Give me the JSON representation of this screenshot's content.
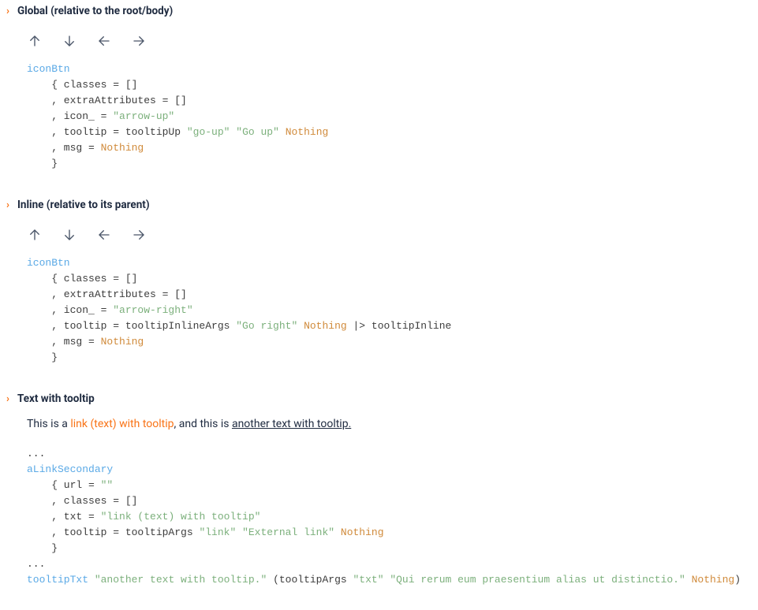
{
  "sections": {
    "global": {
      "title": "Global (relative to the root/body)",
      "code": {
        "fn": "iconBtn",
        "l1": "    { classes = []",
        "l2": "    , extraAttributes = []",
        "l3a": "    , icon_ = ",
        "l3b": "\"arrow-up\"",
        "l4a": "    , tooltip = tooltipUp ",
        "l4b": "\"go-up\"",
        "l4c": " ",
        "l4d": "\"Go up\"",
        "l4e": " ",
        "l4f": "Nothing",
        "l5a": "    , msg = ",
        "l5b": "Nothing",
        "l6": "    }"
      }
    },
    "inline": {
      "title": "Inline (relative to its parent)",
      "code": {
        "fn": "iconBtn",
        "l1": "    { classes = []",
        "l2": "    , extraAttributes = []",
        "l3a": "    , icon_ = ",
        "l3b": "\"arrow-right\"",
        "l4a": "    , tooltip = tooltipInlineArgs ",
        "l4b": "\"Go right\"",
        "l4c": " ",
        "l4d": "Nothing",
        "l4e": " |> tooltipInline",
        "l5a": "    , msg = ",
        "l5b": "Nothing",
        "l6": "    }"
      }
    },
    "text": {
      "title": "Text with tooltip",
      "body": {
        "t1": "This is a ",
        "link": "link (text) with tooltip",
        "t2": ", and this is ",
        "ttxt": "another text with tooltip."
      },
      "code": {
        "l0": "...",
        "fn1": "aLinkSecondary",
        "l1a": "    { url = ",
        "l1b": "\"\"",
        "l2": "    , classes = []",
        "l3a": "    , txt = ",
        "l3b": "\"link (text) with tooltip\"",
        "l4a": "    , tooltip = tooltipArgs ",
        "l4b": "\"link\"",
        "l4c": " ",
        "l4d": "\"External link\"",
        "l4e": " ",
        "l4f": "Nothing",
        "l5": "    }",
        "l6": "...",
        "fn2": "tooltipTxt",
        "l7a": " ",
        "l7b": "\"another text with tooltip.\"",
        "l7c": " (tooltipArgs ",
        "l7d": "\"txt\"",
        "l7e": " ",
        "l7f": "\"Qui rerum eum praesentium alias ut distinctio.\"",
        "l7g": " ",
        "l7h": "Nothing",
        "l7i": ")"
      }
    }
  }
}
